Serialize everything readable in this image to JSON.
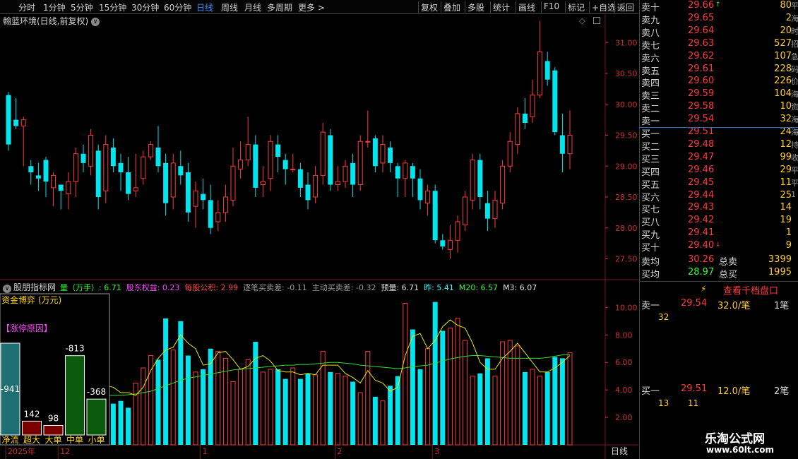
{
  "toolbar": {
    "periods": [
      "分时",
      "1分钟",
      "5分钟",
      "15分钟",
      "30分钟",
      "60分钟",
      "日线",
      "周线",
      "月线",
      "多周期",
      "更多 >"
    ],
    "active_period": "日线",
    "tools": [
      "复权",
      "叠加",
      "多股",
      "统计",
      "画线",
      "F10",
      "标记",
      "+自选",
      "返回"
    ]
  },
  "main_panel": {
    "title": "翰蓝环境(日线,前复权)",
    "price_ticks": [
      "31.00",
      "30.50",
      "30.00",
      "29.50",
      "29.00",
      "28.50",
      "28.00",
      "27.50"
    ]
  },
  "indicator_panel": {
    "title": "股朋指标网",
    "items": [
      {
        "text": "量（万手）: 6.71",
        "color": "#33ff33"
      },
      {
        "text": "股东权益: 0.23",
        "color": "#ff44ff"
      },
      {
        "text": "每股公积: 2.99",
        "color": "#ff4444"
      },
      {
        "text": "逐笔买卖差: -0.11",
        "color": "#999999"
      },
      {
        "text": "主动买卖差: -0.32",
        "color": "#999999"
      },
      {
        "text": "预量: 6.71",
        "color": "#e0e0e0"
      },
      {
        "text": "昨: 5.41",
        "color": "#33ffff"
      },
      {
        "text": "M20: 6.57",
        "color": "#33ff33"
      },
      {
        "text": "M3: 6.07",
        "color": "#e0e0e0"
      }
    ],
    "vol_ticks": [
      "10.00",
      "8.00",
      "6.00",
      "4.00",
      "2.00"
    ]
  },
  "fund_flow": {
    "title": "资金博弈 (万元)",
    "tag": "【涨停原因】",
    "bars": [
      {
        "label": "净流",
        "value": -941,
        "color": "#1d6f72"
      },
      {
        "label": "超大",
        "value": 142,
        "color": "#7a0000"
      },
      {
        "label": "大单",
        "value": 98,
        "color": "#7a0000"
      },
      {
        "label": "中单",
        "value": -813,
        "color": "#0c5a0c"
      },
      {
        "label": "小单",
        "value": -368,
        "color": "#0c5a0c"
      }
    ]
  },
  "date_axis": {
    "labels": [
      {
        "text": "2025年",
        "i": 0
      },
      {
        "text": "12",
        "i": 7
      },
      {
        "text": "1",
        "i": 26
      },
      {
        "text": "2",
        "i": 44
      },
      {
        "text": "3",
        "i": 57
      }
    ],
    "period": "日线"
  },
  "order_book": {
    "sells": [
      {
        "label": "卖十",
        "price": "29.66",
        "vol": "80",
        "mark": "↑"
      },
      {
        "label": "卖九",
        "price": "29.65",
        "vol": "2"
      },
      {
        "label": "卖八",
        "price": "29.64",
        "vol": "20"
      },
      {
        "label": "卖七",
        "price": "29.63",
        "vol": "527"
      },
      {
        "label": "卖六",
        "price": "29.62",
        "vol": "107"
      },
      {
        "label": "卖五",
        "price": "29.61",
        "vol": "228"
      },
      {
        "label": "卖四",
        "price": "29.60",
        "vol": "226"
      },
      {
        "label": "卖三",
        "price": "29.59",
        "vol": "104"
      },
      {
        "label": "卖二",
        "price": "29.58",
        "vol": "10"
      },
      {
        "label": "卖一",
        "price": "29.54",
        "vol": "32"
      }
    ],
    "buys": [
      {
        "label": "买一",
        "price": "29.51",
        "vol": "24"
      },
      {
        "label": "买二",
        "price": "29.48",
        "vol": "12"
      },
      {
        "label": "买三",
        "price": "29.47",
        "vol": "99"
      },
      {
        "label": "买四",
        "price": "29.46",
        "vol": "29"
      },
      {
        "label": "买五",
        "price": "29.45",
        "vol": "11"
      },
      {
        "label": "买六",
        "price": "29.44",
        "vol": "25"
      },
      {
        "label": "买七",
        "price": "29.43",
        "vol": "14"
      },
      {
        "label": "买八",
        "price": "29.42",
        "vol": "19"
      },
      {
        "label": "买九",
        "price": "29.41",
        "vol": "1"
      },
      {
        "label": "买十",
        "price": "29.40",
        "vol": "9",
        "mark": "↓"
      }
    ],
    "right_cut": [
      "平",
      "海",
      "时",
      "招",
      "急",
      "码",
      "价",
      "海",
      "资",
      "海",
      "海",
      "持",
      "收",
      "平",
      "平",
      "1"
    ],
    "avg_sell": {
      "label": "卖均",
      "price": "30.26",
      "total_label": "总卖",
      "total": "3399"
    },
    "avg_buy": {
      "label": "买均",
      "price": "28.97",
      "total_label": "总买",
      "total": "1995"
    }
  },
  "tick_panel": {
    "button": "查看千档盘口",
    "sell1": {
      "label": "卖一",
      "price": "29.54",
      "amount": "32.0/笔",
      "count": "1笔",
      "detail": [
        "32"
      ]
    },
    "buy1": {
      "label": "买一",
      "price": "29.51",
      "amount": "12.0/笔",
      "count": "2笔",
      "detail": [
        "13",
        "11"
      ]
    }
  },
  "watermark": {
    "line1": "乐淘公式网",
    "line2": "www.60lt.com"
  },
  "colors": {
    "up": "#ff3b3b",
    "down": "#00e5ee",
    "ma3": "#e8e800",
    "ma20": "#33dd33",
    "grid": "#7a1a1a"
  },
  "chart_data": {
    "type": "candlestick",
    "title": "翰蓝环境(日线,前复权)",
    "ylim": [
      27.3,
      31.3
    ],
    "candles": [
      [
        30.15,
        30.15,
        29.35,
        29.25,
        30.2
      ],
      [
        29.75,
        30.0,
        29.65,
        29.6,
        30.1
      ],
      [
        29.65,
        29.25,
        29.75,
        29.0,
        29.8
      ],
      [
        29.0,
        29.0,
        28.9,
        28.7,
        29.1
      ],
      [
        28.85,
        28.85,
        28.8,
        28.6,
        29.05
      ],
      [
        29.1,
        29.1,
        28.75,
        28.5,
        29.15
      ],
      [
        28.65,
        28.65,
        28.85,
        28.35,
        28.9
      ],
      [
        28.7,
        28.7,
        28.6,
        28.3,
        28.7
      ],
      [
        28.55,
        28.55,
        28.75,
        28.3,
        28.9
      ],
      [
        28.75,
        28.75,
        29.2,
        28.5,
        29.3
      ],
      [
        29.2,
        29.2,
        29.05,
        28.9,
        29.35
      ],
      [
        29.0,
        29.0,
        29.5,
        28.85,
        29.6
      ],
      [
        29.25,
        29.25,
        28.5,
        28.3,
        29.35
      ],
      [
        28.6,
        28.6,
        29.35,
        28.4,
        29.5
      ],
      [
        29.3,
        29.3,
        29.0,
        28.9,
        29.45
      ],
      [
        29.05,
        29.05,
        28.9,
        28.6,
        29.2
      ],
      [
        28.9,
        28.9,
        28.55,
        28.45,
        29.15
      ],
      [
        28.6,
        28.6,
        28.65,
        28.5,
        29.2
      ],
      [
        28.8,
        28.8,
        29.15,
        28.7,
        29.25
      ],
      [
        29.15,
        29.15,
        29.35,
        29.1,
        29.4
      ],
      [
        29.3,
        29.3,
        29.0,
        28.9,
        29.65
      ],
      [
        29.05,
        29.05,
        28.4,
        28.2,
        29.2
      ],
      [
        28.5,
        28.5,
        29.05,
        28.3,
        29.2
      ],
      [
        29.0,
        29.0,
        28.85,
        28.7,
        29.25
      ],
      [
        28.9,
        28.9,
        28.25,
        28.1,
        29.05
      ],
      [
        28.35,
        28.35,
        28.6,
        28.0,
        28.75
      ],
      [
        28.55,
        28.55,
        28.45,
        28.3,
        28.8
      ],
      [
        28.45,
        28.45,
        28.0,
        27.9,
        28.7
      ],
      [
        28.1,
        28.1,
        28.25,
        27.95,
        28.45
      ],
      [
        28.25,
        28.25,
        28.5,
        28.1,
        28.7
      ],
      [
        28.45,
        28.45,
        29.0,
        28.35,
        29.3
      ],
      [
        28.95,
        28.95,
        29.1,
        28.8,
        29.4
      ],
      [
        29.1,
        29.1,
        29.35,
        29.0,
        29.8
      ],
      [
        29.35,
        29.35,
        28.65,
        28.5,
        29.5
      ],
      [
        28.7,
        28.7,
        28.75,
        28.5,
        29.0
      ],
      [
        28.8,
        28.8,
        29.4,
        28.6,
        29.5
      ],
      [
        29.35,
        29.35,
        29.15,
        28.9,
        29.5
      ],
      [
        29.1,
        29.1,
        28.95,
        28.7,
        29.2
      ],
      [
        28.95,
        28.95,
        28.95,
        28.9,
        29.2
      ],
      [
        28.95,
        28.95,
        28.65,
        28.5,
        29.05
      ],
      [
        28.7,
        28.7,
        28.45,
        28.3,
        28.9
      ],
      [
        28.5,
        28.5,
        28.85,
        28.4,
        29.0
      ],
      [
        28.85,
        28.85,
        29.55,
        28.7,
        29.7
      ],
      [
        29.5,
        29.5,
        28.7,
        28.6,
        29.6
      ],
      [
        28.7,
        28.7,
        28.75,
        28.6,
        29.0
      ],
      [
        28.75,
        28.75,
        29.0,
        28.65,
        29.1
      ],
      [
        29.05,
        29.05,
        28.7,
        28.5,
        29.2
      ],
      [
        28.7,
        28.7,
        29.4,
        28.6,
        29.5
      ],
      [
        29.4,
        29.4,
        29.4,
        29.3,
        29.9
      ],
      [
        29.45,
        29.45,
        29.0,
        28.9,
        29.5
      ],
      [
        29.05,
        29.05,
        29.35,
        28.9,
        29.5
      ],
      [
        29.3,
        29.3,
        29.05,
        28.9,
        29.4
      ],
      [
        29.0,
        29.0,
        28.8,
        28.5,
        29.05
      ],
      [
        28.8,
        28.8,
        29.05,
        28.5,
        29.1
      ],
      [
        29.0,
        29.0,
        28.8,
        28.5,
        29.05
      ],
      [
        28.8,
        28.8,
        28.45,
        28.3,
        28.95
      ],
      [
        28.4,
        28.4,
        28.6,
        28.2,
        28.7
      ],
      [
        28.6,
        28.6,
        27.8,
        27.75,
        28.7
      ],
      [
        27.8,
        27.8,
        27.7,
        27.65,
        27.9
      ],
      [
        27.65,
        27.65,
        27.8,
        27.5,
        28.05
      ],
      [
        27.8,
        27.8,
        28.1,
        27.6,
        28.2
      ],
      [
        28.05,
        28.05,
        28.5,
        27.95,
        28.6
      ],
      [
        28.45,
        28.45,
        29.1,
        28.3,
        29.2
      ],
      [
        29.1,
        29.1,
        28.5,
        28.3,
        29.2
      ],
      [
        28.4,
        28.4,
        28.15,
        27.95,
        28.6
      ],
      [
        28.15,
        28.15,
        28.45,
        28.0,
        28.6
      ],
      [
        28.4,
        28.4,
        29.0,
        28.3,
        29.1
      ],
      [
        29.0,
        29.0,
        29.4,
        28.9,
        29.55
      ],
      [
        29.35,
        29.35,
        29.85,
        29.2,
        29.95
      ],
      [
        29.85,
        29.85,
        29.7,
        29.6,
        30.1
      ],
      [
        29.8,
        29.8,
        30.15,
        29.7,
        30.4
      ],
      [
        30.15,
        30.15,
        30.85,
        30.1,
        31.35
      ],
      [
        30.7,
        30.7,
        30.4,
        30.3,
        30.85
      ],
      [
        30.55,
        30.55,
        29.55,
        29.5,
        30.6
      ],
      [
        29.5,
        29.5,
        29.2,
        28.9,
        29.85
      ],
      [
        29.2,
        29.2,
        29.5,
        28.95,
        29.9
      ]
    ],
    "volume": [
      2.2,
      5.2,
      6.6,
      3.3,
      3.2,
      1.9,
      4.0,
      3.2,
      3.5,
      4.3,
      3.1,
      3.3,
      5.6,
      4.6,
      3.0,
      3.2,
      2.7,
      4.5,
      5.6,
      6.5,
      6.2,
      9.2,
      6.9,
      9.0,
      6.5,
      5.3,
      5.5,
      7.0,
      6.8,
      6.3,
      4.6,
      5.5,
      6.2,
      7.5,
      5.3,
      5.5,
      5.5,
      4.8,
      5.6,
      4.8,
      5.2,
      5.1,
      6.8,
      5.3,
      5.2,
      5.0,
      4.6,
      3.8,
      6.8,
      3.5,
      3.2,
      4.3,
      5.0,
      10.3,
      8.4,
      5.5,
      7.0,
      10.4,
      8.3,
      8.5,
      9.2,
      7.6,
      5.0,
      5.2,
      6.3,
      5.0,
      7.5,
      7.6,
      7.2,
      5.3,
      5.5,
      5.0,
      5.3,
      6.4,
      6.3,
      6.7
    ],
    "volume_ylim": [
      0,
      11.2
    ],
    "ma3": [
      4.2,
      4.2,
      4.4,
      4.3,
      3.8,
      3.6,
      3.3,
      3.4,
      3.5,
      3.6,
      3.7,
      3.6,
      3.8,
      4.3,
      4.2,
      3.8,
      3.8,
      3.6,
      4.2,
      5.4,
      6.3,
      6.9,
      7.1,
      8.0,
      7.4,
      7.0,
      5.8,
      5.9,
      6.7,
      6.8,
      6.2,
      5.5,
      5.7,
      6.3,
      6.5,
      6.1,
      5.4,
      5.3,
      5.3,
      5.1,
      5.2,
      5.1,
      5.8,
      5.8,
      5.8,
      5.2,
      4.9,
      4.5,
      5.4,
      4.7,
      4.5,
      3.9,
      4.2,
      6.5,
      7.9,
      8.1,
      7.0,
      7.6,
      8.6,
      9.1,
      8.7,
      8.5,
      7.4,
      6.0,
      5.5,
      5.5,
      6.3,
      6.8,
      7.4,
      6.7,
      6.0,
      5.3,
      5.3,
      5.6,
      6.0,
      6.5
    ],
    "ma20": [
      4.1,
      4.05,
      4.0,
      3.95,
      3.9,
      3.85,
      3.8,
      3.75,
      3.7,
      3.7,
      3.65,
      3.6,
      3.6,
      3.6,
      3.6,
      3.6,
      3.65,
      3.7,
      3.8,
      3.9,
      4.1,
      4.3,
      4.5,
      4.7,
      4.85,
      4.95,
      5.05,
      5.15,
      5.25,
      5.35,
      5.45,
      5.5,
      5.55,
      5.6,
      5.65,
      5.7,
      5.75,
      5.8,
      5.8,
      5.85,
      5.85,
      5.9,
      5.95,
      6.0,
      6.0,
      5.95,
      5.9,
      5.8,
      5.75,
      5.7,
      5.65,
      5.6,
      5.55,
      5.6,
      5.7,
      5.75,
      5.8,
      5.95,
      6.1,
      6.25,
      6.35,
      6.45,
      6.5,
      6.5,
      6.45,
      6.4,
      6.35,
      6.3,
      6.3,
      6.3,
      6.3,
      6.3,
      6.35,
      6.45,
      6.55,
      6.57
    ]
  }
}
